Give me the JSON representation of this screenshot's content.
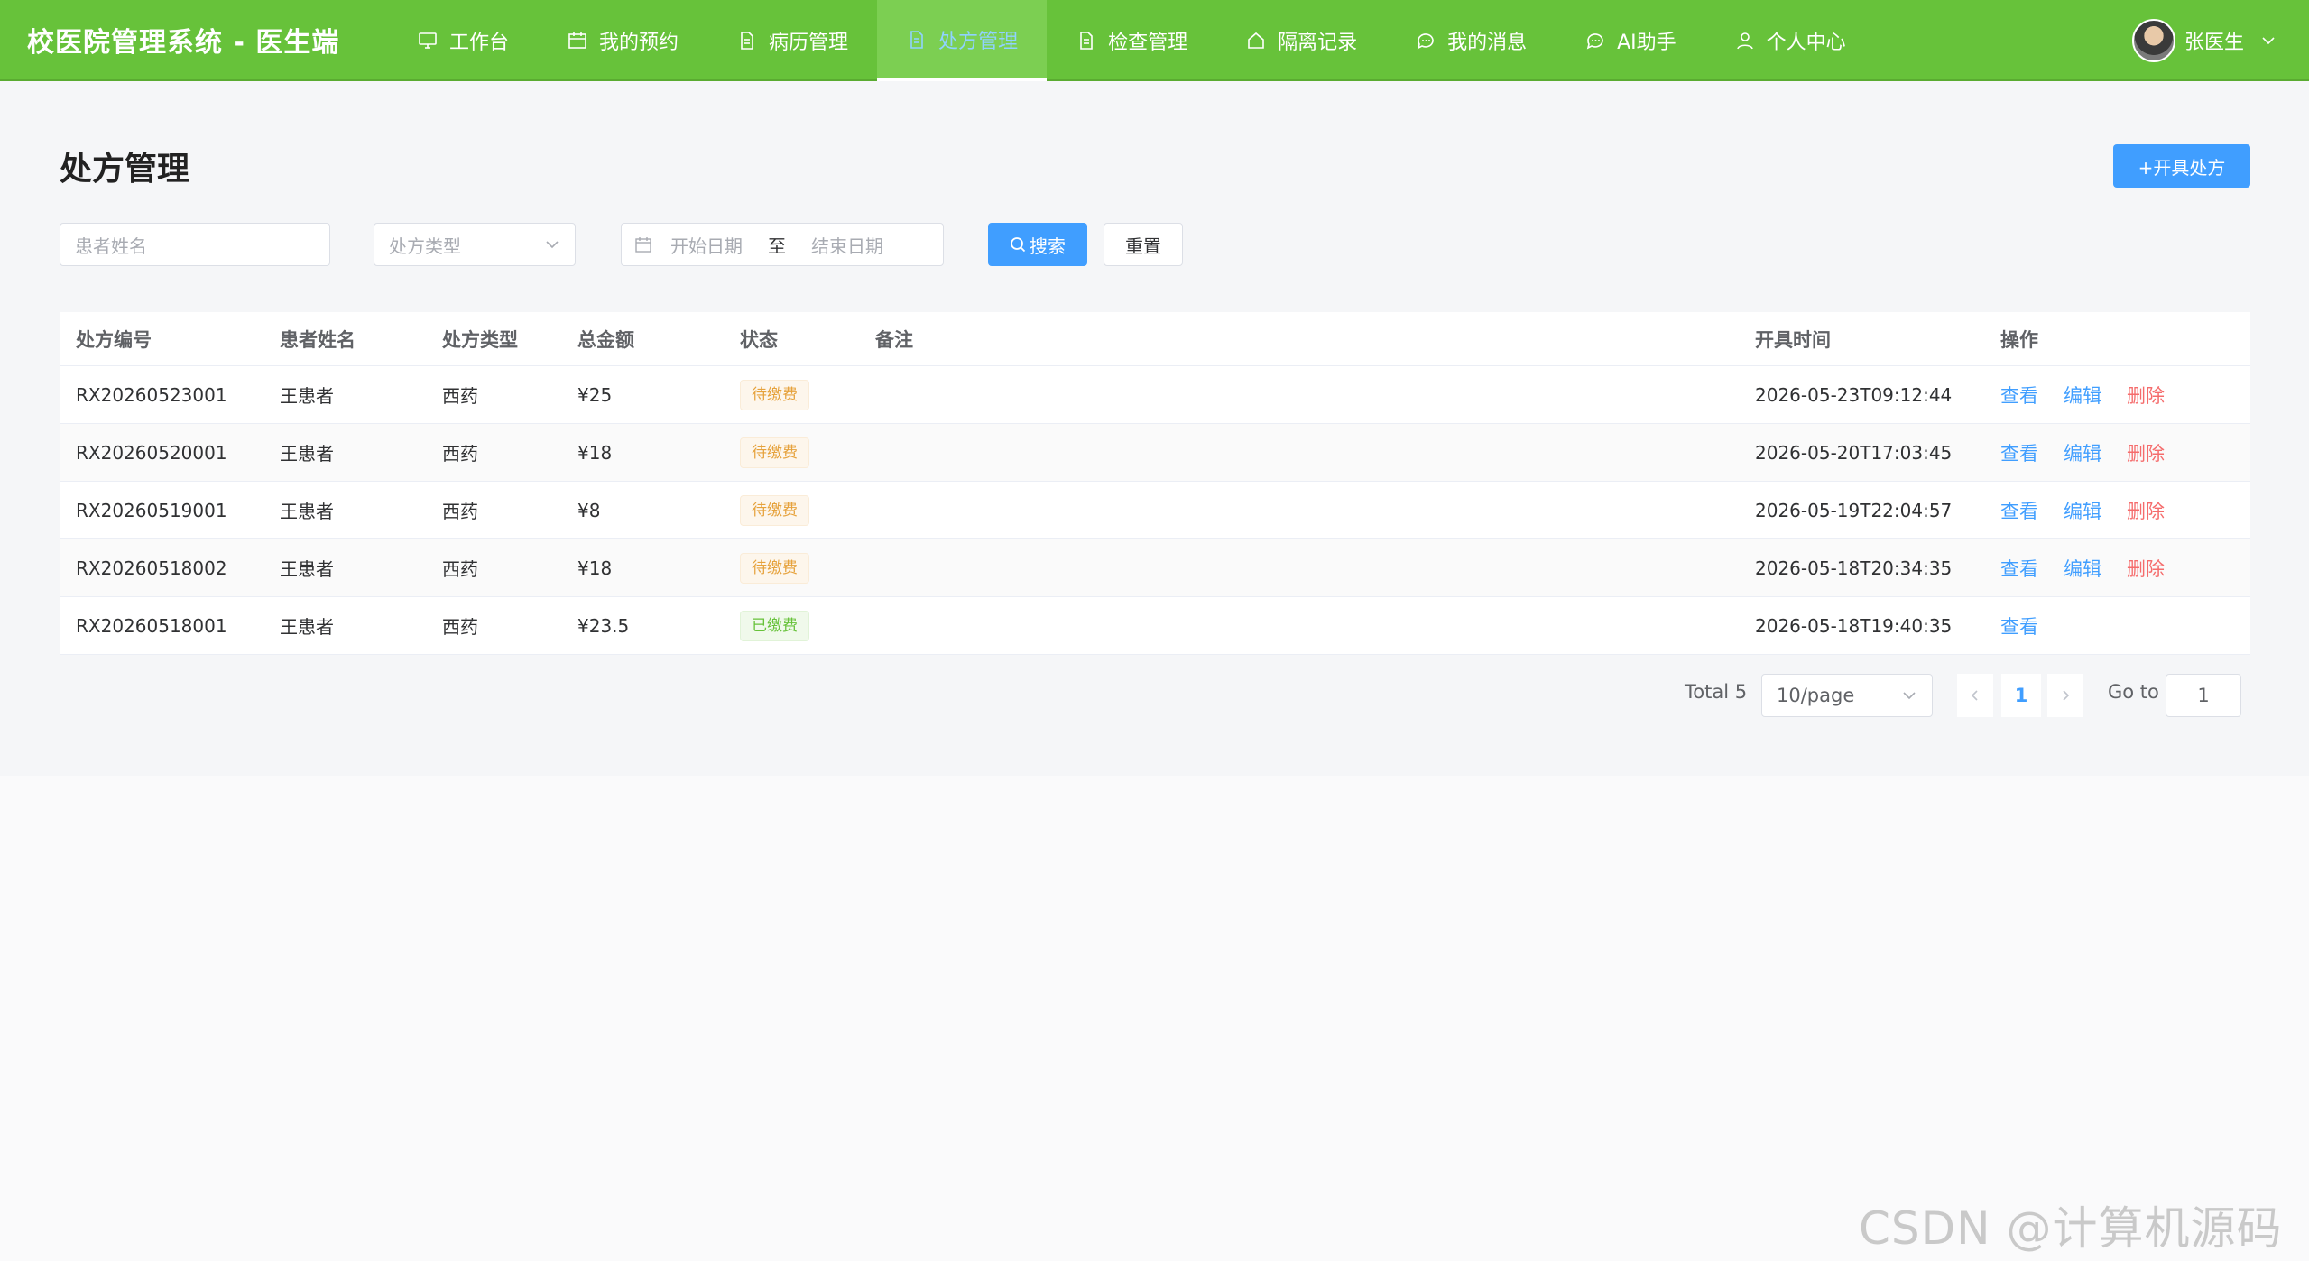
{
  "app": {
    "title": "校医院管理系统 - 医生端"
  },
  "nav": {
    "items": [
      {
        "label": "工作台",
        "icon": "monitor-icon"
      },
      {
        "label": "我的预约",
        "icon": "calendar-icon"
      },
      {
        "label": "病历管理",
        "icon": "document-icon"
      },
      {
        "label": "处方管理",
        "icon": "document-icon",
        "active": true
      },
      {
        "label": "检查管理",
        "icon": "document-icon"
      },
      {
        "label": "隔离记录",
        "icon": "house-icon"
      },
      {
        "label": "我的消息",
        "icon": "chat-icon"
      },
      {
        "label": "AI助手",
        "icon": "chat-icon"
      },
      {
        "label": "个人中心",
        "icon": "user-icon"
      }
    ]
  },
  "user": {
    "name": "张医生"
  },
  "page": {
    "title": "处方管理",
    "create_label": "+开具处方"
  },
  "filters": {
    "patient_placeholder": "患者姓名",
    "type_placeholder": "处方类型",
    "start_placeholder": "开始日期",
    "range_separator": "至",
    "end_placeholder": "结束日期",
    "search_label": "搜索",
    "reset_label": "重置"
  },
  "table": {
    "headers": [
      "处方编号",
      "患者姓名",
      "处方类型",
      "总金额",
      "状态",
      "备注",
      "开具时间",
      "操作"
    ],
    "rows": [
      {
        "id": "RX20260523001",
        "patient": "王患者",
        "type": "西药",
        "amount": "¥25",
        "status": "待缴费",
        "note": "",
        "time": "2026-05-23T09:12:44",
        "actions": [
          "查看",
          "编辑",
          "删除"
        ]
      },
      {
        "id": "RX20260520001",
        "patient": "王患者",
        "type": "西药",
        "amount": "¥18",
        "status": "待缴费",
        "note": "",
        "time": "2026-05-20T17:03:45",
        "actions": [
          "查看",
          "编辑",
          "删除"
        ]
      },
      {
        "id": "RX20260519001",
        "patient": "王患者",
        "type": "西药",
        "amount": "¥8",
        "status": "待缴费",
        "note": "",
        "time": "2026-05-19T22:04:57",
        "actions": [
          "查看",
          "编辑",
          "删除"
        ]
      },
      {
        "id": "RX20260518002",
        "patient": "王患者",
        "type": "西药",
        "amount": "¥18",
        "status": "待缴费",
        "note": "",
        "time": "2026-05-18T20:34:35",
        "actions": [
          "查看",
          "编辑",
          "删除"
        ]
      },
      {
        "id": "RX20260518001",
        "patient": "王患者",
        "type": "西药",
        "amount": "¥23.5",
        "status": "已缴费",
        "note": "",
        "time": "2026-05-18T19:40:35",
        "actions": [
          "查看"
        ]
      }
    ]
  },
  "pagination": {
    "total_label": "Total 5",
    "page_size": "10/page",
    "current_page": "1",
    "goto_label": "Go to",
    "goto_value": "1"
  },
  "watermark": "CSDN @计算机源码站",
  "colors": {
    "nav_bg": "#67c23a",
    "primary": "#409eff",
    "danger": "#f56c6c",
    "warning": "#e6a23c",
    "success": "#67c23a"
  }
}
